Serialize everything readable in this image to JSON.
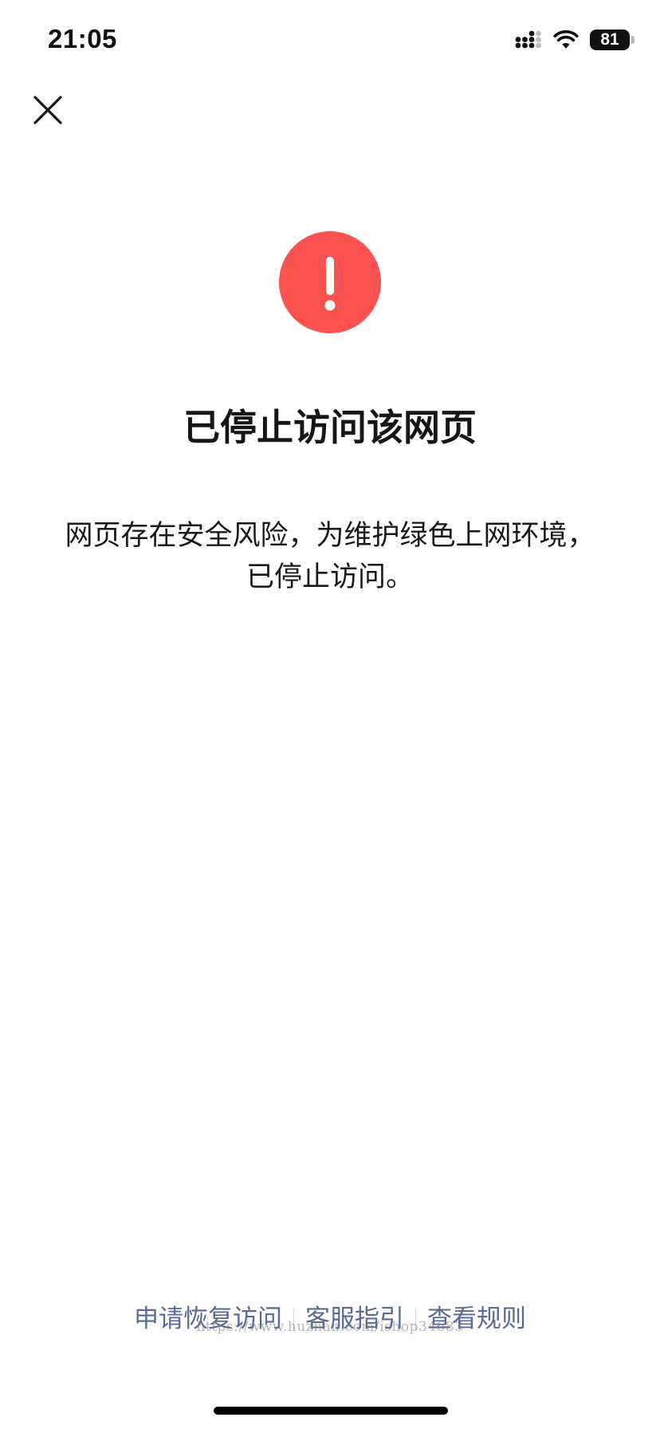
{
  "status_bar": {
    "time": "21:05",
    "battery_level": "81",
    "icons": [
      "signal-icon",
      "wifi-icon",
      "battery-icon"
    ]
  },
  "header": {
    "close_icon": "close-icon"
  },
  "warning": {
    "icon": "exclamation-circle-icon",
    "color": "#fa5151"
  },
  "main": {
    "title": "已停止访问该网页",
    "description": "网页存在安全风险，为维护绿色上网环境，已停止访问。"
  },
  "footer": {
    "links": [
      {
        "label": "申请恢复访问"
      },
      {
        "label": "客服指引"
      },
      {
        "label": "查看规则"
      }
    ],
    "link_color": "#576b95",
    "watermark": "https://www.huzhan.com/ishop34683"
  }
}
